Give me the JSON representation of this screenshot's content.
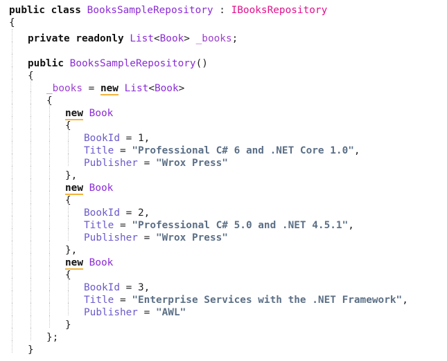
{
  "code": {
    "class_decl": {
      "kw_public": "public",
      "kw_class": "class",
      "class_name": "BooksSampleRepository",
      "colon": " : ",
      "interface_name": "IBooksRepository"
    },
    "brace_open": "{",
    "brace_close": "}",
    "field_decl": {
      "kw_private": "private",
      "kw_readonly": "readonly",
      "list_type": "List",
      "lt": "<",
      "book_type": "Book",
      "gt": ">",
      "field_name": "_books",
      "semicolon": ";"
    },
    "ctor_decl": {
      "kw_public": "public",
      "ctor_name": "BooksSampleRepository",
      "parens": "()"
    },
    "assign": {
      "field_name": "_books",
      "equals": " = ",
      "kw_new": "new",
      "list_type": "List",
      "lt": "<",
      "book_type": "Book",
      "gt": ">"
    },
    "new_book_kw": "new",
    "new_book_type": "Book",
    "close_comma": "},",
    "close_semicolon": "};",
    "prop_bookid": "BookId",
    "prop_title": "Title",
    "prop_publisher": "Publisher",
    "eq": " = ",
    "comma": ",",
    "books": [
      {
        "id": "1",
        "title": "\"Professional C# 6 and .NET Core 1.0\"",
        "publisher": "\"Wrox Press\""
      },
      {
        "id": "2",
        "title": "\"Professional C# 5.0 and .NET 4.5.1\"",
        "publisher": "\"Wrox Press\""
      },
      {
        "id": "3",
        "title": "\"Enterprise Services with the .NET Framework\"",
        "publisher": "\"AWL\""
      }
    ]
  }
}
